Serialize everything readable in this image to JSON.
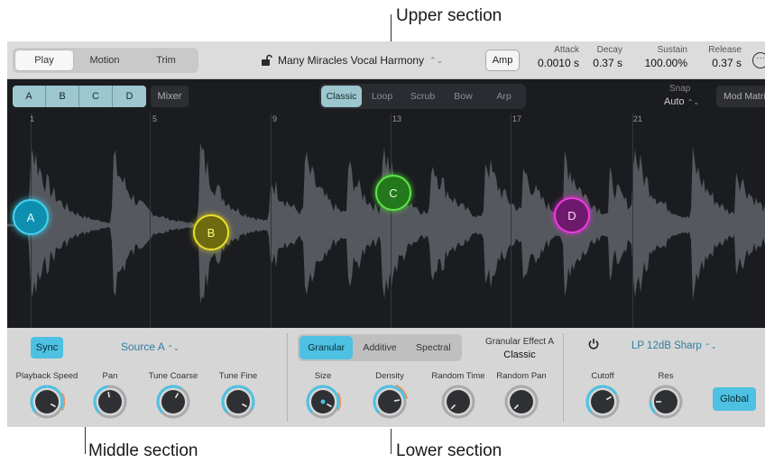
{
  "callouts": {
    "upper": "Upper section",
    "middle": "Middle section",
    "lower": "Lower section"
  },
  "upper": {
    "view_tabs": [
      "Play",
      "Motion",
      "Trim"
    ],
    "active_view": "Play",
    "preset_name": "Many Miracles Vocal Harmony",
    "amp_label": "Amp",
    "envelope": [
      {
        "label": "Attack",
        "value": "0.0010 s"
      },
      {
        "label": "Decay",
        "value": "0.37 s"
      },
      {
        "label": "Sustain",
        "value": "100.00%"
      },
      {
        "label": "Release",
        "value": "0.37 s"
      }
    ]
  },
  "middle": {
    "sources": [
      "A",
      "B",
      "C",
      "D"
    ],
    "mixer_label": "Mixer",
    "play_modes": [
      "Classic",
      "Loop",
      "Scrub",
      "Bow",
      "Arp"
    ],
    "active_mode": "Classic",
    "snap_label": "Snap",
    "snap_value": "Auto",
    "mod_matrix_label": "Mod Matrix",
    "bar_numbers": [
      "1",
      "5",
      "9",
      "13",
      "17",
      "21"
    ],
    "markers": [
      "A",
      "B",
      "C",
      "D"
    ],
    "colors": {
      "A": "#45d2ef",
      "B": "#e8df2a",
      "C": "#5de448",
      "D": "#ee3ae0"
    }
  },
  "lower": {
    "sync_label": "Sync",
    "source_select": "Source A",
    "engines": [
      "Granular",
      "Additive",
      "Spectral"
    ],
    "active_engine": "Granular",
    "effect_label": "Granular Effect A",
    "effect_value": "Classic",
    "filter_type": "LP 12dB Sharp",
    "global_label": "Global",
    "knobs": [
      {
        "label": "Playback Speed"
      },
      {
        "label": "Pan"
      },
      {
        "label": "Tune Coarse"
      },
      {
        "label": "Tune Fine"
      },
      {
        "label": "Size"
      },
      {
        "label": "Density"
      },
      {
        "label": "Random Time"
      },
      {
        "label": "Random Pan"
      },
      {
        "label": "Cutoff"
      },
      {
        "label": "Res"
      }
    ]
  },
  "accent_color": "#4dc1e2"
}
